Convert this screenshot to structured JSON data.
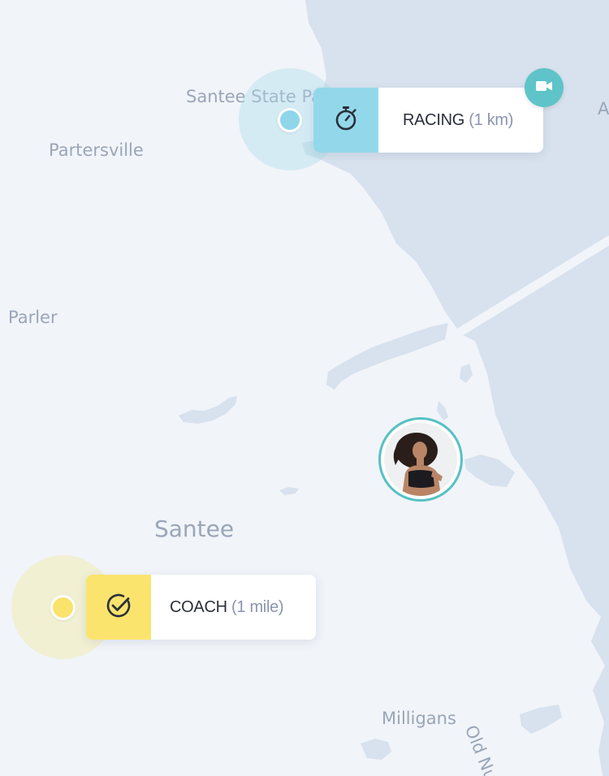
{
  "map": {
    "place_labels": {
      "santee_state_park": "Santee State Pa",
      "partersville": "Partersville",
      "parler": "Parler",
      "santee": "Santee",
      "milligans": "Milligans",
      "old_nu": "Old Nu",
      "edge_a": "A"
    },
    "colors": {
      "land": "#f1f4f9",
      "water": "#d7e2ee",
      "racing_accent": "#93d8ea",
      "coach_accent": "#fbe46d",
      "teal": "#5ec4c9"
    }
  },
  "markers": {
    "racing": {
      "name": "RACING",
      "distance": "(1 km)",
      "icon": "stopwatch-icon"
    },
    "coach": {
      "name": "COACH",
      "distance": "(1 mile)",
      "icon": "check-circle-icon"
    }
  },
  "controls": {
    "camera_icon": "video-camera-icon"
  },
  "runner": {
    "avatar": "runner-avatar"
  }
}
